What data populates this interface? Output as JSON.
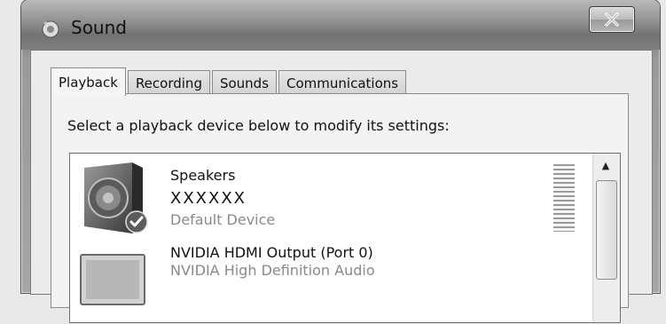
{
  "window": {
    "title": "Sound",
    "title_icon": "speaker-icon",
    "close_icon": "close-icon"
  },
  "tabs": [
    {
      "label": "Playback",
      "active": true
    },
    {
      "label": "Recording",
      "active": false
    },
    {
      "label": "Sounds",
      "active": false
    },
    {
      "label": "Communications",
      "active": false
    }
  ],
  "playback": {
    "instruction": "Select a playback device below to modify its settings:",
    "devices": [
      {
        "name": "Speakers",
        "description": "XXXXXX",
        "status": "Default Device",
        "icon": "speaker-device-icon",
        "is_default": true
      },
      {
        "name": "NVIDIA HDMI Output (Port 0)",
        "description": "NVIDIA High Definition Audio",
        "status": "",
        "icon": "monitor-device-icon",
        "is_default": false
      }
    ]
  }
}
